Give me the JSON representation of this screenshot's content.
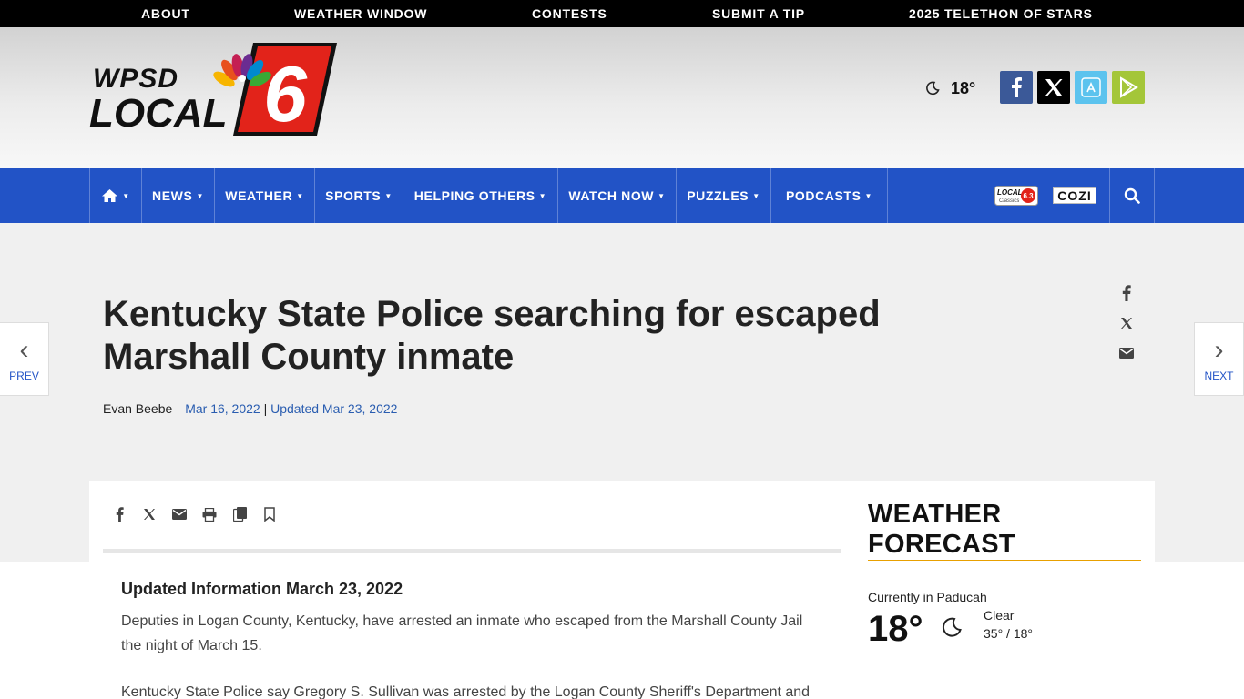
{
  "topnav": {
    "items": [
      {
        "label": "ABOUT"
      },
      {
        "label": "WEATHER WINDOW"
      },
      {
        "label": "CONTESTS"
      },
      {
        "label": "SUBMIT A TIP"
      },
      {
        "label": "2025 TELETHON OF STARS"
      }
    ]
  },
  "masthead": {
    "logo_line1": "WPSD",
    "logo_line2": "LOCAL",
    "logo_number": "6",
    "current_temp": "18°",
    "social_icons": [
      "facebook-icon",
      "x-icon",
      "app-store-icon",
      "google-play-icon"
    ],
    "social_colors": [
      "#3b5998",
      "#000000",
      "#5cc3ee",
      "#a4c639"
    ]
  },
  "mainnav": {
    "items": [
      {
        "label": "NEWS"
      },
      {
        "label": "WEATHER"
      },
      {
        "label": "SPORTS"
      },
      {
        "label": "HELPING OTHERS"
      },
      {
        "label": "WATCH NOW"
      },
      {
        "label": "PUZZLES"
      },
      {
        "label": "PODCASTS"
      }
    ],
    "badge_local_line1": "LOCAL",
    "badge_local_line2": "Classics",
    "badge_local_number": "6.3",
    "badge_cozi": "COZI",
    "accent_color": "#2253c6"
  },
  "article": {
    "prev_label": "PREV",
    "next_label": "NEXT",
    "headline_line1": "Kentucky State Police searching for escaped",
    "headline_line2": "Marshall County inmate",
    "author": "Evan Beebe",
    "published": "Mar 16, 2022",
    "separator": "|",
    "updated": "Updated Mar 23, 2022",
    "body_heading": "Updated Information March 23, 2022",
    "body_p1_line1": "Deputies in Logan County, Kentucky, have arrested an inmate who escaped from the Marshall County Jail",
    "body_p1_line2": "the night of March 15.",
    "body_p2_line1": "Kentucky State Police say Gregory S. Sullivan was arrested by the Logan County Sheriff's Department and"
  },
  "sidebar": {
    "title_line1": "WEATHER",
    "title_line2": "FORECAST",
    "location": "Currently in Paducah",
    "temp": "18°",
    "condition": "Clear",
    "hilo": "35° / 18°"
  }
}
